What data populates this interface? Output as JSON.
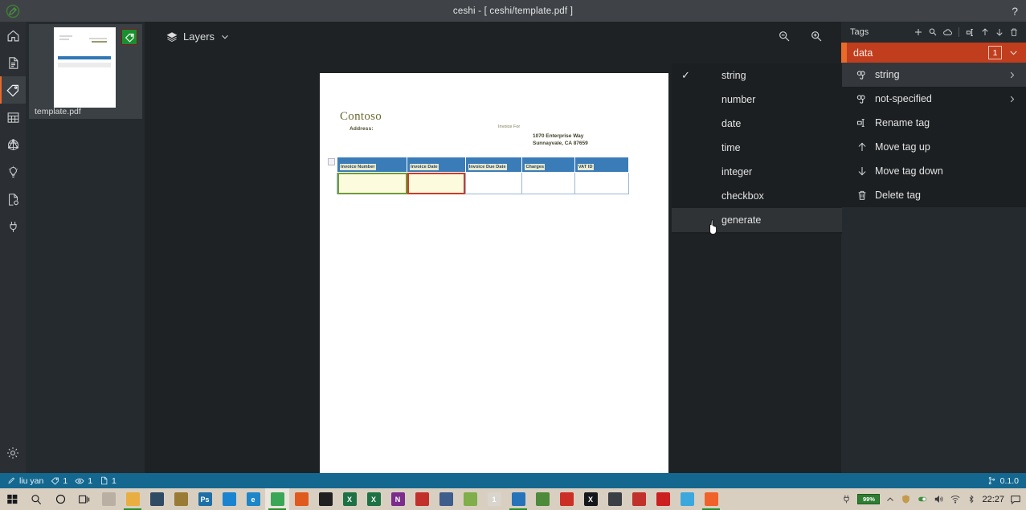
{
  "window": {
    "title": "ceshi - [ ceshi/template.pdf ]",
    "logo_icon": "tag-logo-icon",
    "help_icon": "help-question-icon"
  },
  "rail": {
    "items": [
      {
        "name": "home",
        "icon": "home-icon",
        "active": false
      },
      {
        "name": "documents",
        "icon": "document-icon",
        "active": false
      },
      {
        "name": "tags",
        "icon": "tag-icon",
        "active": true
      },
      {
        "name": "table",
        "icon": "table-grid-icon",
        "active": false
      },
      {
        "name": "model",
        "icon": "neural-model-icon",
        "active": false
      },
      {
        "name": "predict",
        "icon": "lightbulb-icon",
        "active": false
      },
      {
        "name": "compose",
        "icon": "document-gear-icon",
        "active": false
      },
      {
        "name": "connections",
        "icon": "plug-connection-icon",
        "active": false
      }
    ],
    "settings": {
      "name": "settings",
      "icon": "gear-icon"
    }
  },
  "document_panel": {
    "file_name": "template.pdf",
    "badge_icon": "tag-badge-icon"
  },
  "editor_toolbar": {
    "layers_label": "Layers",
    "layers_icon": "layers-icon",
    "chevron_icon": "chevron-down-icon",
    "zoom_out_icon": "zoom-out-icon",
    "zoom_in_icon": "zoom-in-icon"
  },
  "page_document": {
    "company": "Contoso",
    "address_label": "Address:",
    "invoice_for_label": "Invoice For",
    "address_lines": "1070 Enterprise Way<br>Sunnayvale, CA 87659",
    "address_line_1": "1070 Enterprise Way",
    "address_line_2": "Sunnayvale, CA 87659",
    "table": {
      "headers": [
        "Invoice Number",
        "Invoice Date",
        "Invoice Due Date",
        "Charges",
        "VAT ID"
      ],
      "rows": [
        [
          "",
          "",
          "",
          "",
          ""
        ]
      ],
      "selected_cells": [
        {
          "index": 0,
          "outline_color": "#6e9b3a"
        },
        {
          "index": 1,
          "outline_color": "#cc3b2a"
        }
      ],
      "header_bg": "#3a7cb8",
      "header_text_highlight": "#e7e8cd"
    }
  },
  "type_submenu": {
    "items": [
      {
        "label": "string",
        "checked": true,
        "hover": false
      },
      {
        "label": "number",
        "checked": false,
        "hover": false
      },
      {
        "label": "date",
        "checked": false,
        "hover": false
      },
      {
        "label": "time",
        "checked": false,
        "hover": false
      },
      {
        "label": "integer",
        "checked": false,
        "hover": false
      },
      {
        "label": "checkbox",
        "checked": false,
        "hover": false
      },
      {
        "label": "generate",
        "checked": false,
        "hover": true
      }
    ],
    "check_glyph": "✓"
  },
  "tags_panel": {
    "header_label": "Tags",
    "tools": [
      {
        "name": "add-tag",
        "icon": "plus-icon"
      },
      {
        "name": "search-tag",
        "icon": "search-icon"
      },
      {
        "name": "cloud-sync",
        "icon": "cloud-icon"
      },
      {
        "name": "rename-tag",
        "icon": "rename-icon"
      },
      {
        "name": "move-tag-up",
        "icon": "arrow-up-icon"
      },
      {
        "name": "move-tag-down",
        "icon": "arrow-down-icon"
      },
      {
        "name": "delete-tag",
        "icon": "trash-icon"
      }
    ],
    "tag": {
      "name": "data",
      "count": "1",
      "accent_color": "#ea6a2a",
      "row_color": "#c03e1e",
      "caret_icon": "chevron-down-icon"
    },
    "subtags": [
      {
        "label": "string",
        "icon": "link-icon",
        "arrow": "chevron-right-icon",
        "highlighted": true
      },
      {
        "label": "not-specified",
        "icon": "link-icon",
        "arrow": "chevron-right-icon",
        "highlighted": false
      }
    ],
    "context_menu": [
      {
        "label": "Rename tag",
        "icon": "rename-icon"
      },
      {
        "label": "Move tag up",
        "icon": "arrow-up-icon"
      },
      {
        "label": "Move tag down",
        "icon": "arrow-down-icon"
      },
      {
        "label": "Delete tag",
        "icon": "trash-icon"
      }
    ]
  },
  "status_bar": {
    "user": "liu yan",
    "user_icon": "user-pen-icon",
    "metrics": [
      {
        "icon": "tag-icon",
        "value": "1"
      },
      {
        "icon": "eye-icon",
        "value": "1"
      },
      {
        "icon": "document-icon",
        "value": "1"
      }
    ],
    "version": "0.1.0",
    "version_icon": "branch-icon",
    "bg_color": "#14688f"
  },
  "taskbar": {
    "system_buttons": [
      {
        "name": "start",
        "icon": "windows-icon"
      },
      {
        "name": "search",
        "icon": "search-icon"
      },
      {
        "name": "cortana",
        "icon": "circle-icon"
      },
      {
        "name": "task-view",
        "icon": "task-view-icon"
      }
    ],
    "apps": [
      {
        "name": "app-magnifier",
        "label": "",
        "color": "#b9b0a3",
        "running": false,
        "active": false
      },
      {
        "name": "app-explorer",
        "label": "",
        "color": "#e8ae42",
        "running": true,
        "active": false
      },
      {
        "name": "app-media",
        "label": "",
        "color": "#2f4a63",
        "running": false,
        "active": false
      },
      {
        "name": "app-editor",
        "label": "",
        "color": "#9a7b35",
        "running": false,
        "active": false
      },
      {
        "name": "app-photoshop",
        "label": "Ps",
        "color": "#1d6fa5",
        "running": false,
        "active": false
      },
      {
        "name": "app-browser-blue",
        "label": "",
        "color": "#1a84d0",
        "running": false,
        "active": false
      },
      {
        "name": "app-edge",
        "label": "e",
        "color": "#1d86c8",
        "running": false,
        "active": false
      },
      {
        "name": "app-chrome",
        "label": "",
        "color": "#3aa757",
        "running": true,
        "active": true
      },
      {
        "name": "app-firefox",
        "label": "",
        "color": "#e05a1e",
        "running": false,
        "active": false
      },
      {
        "name": "app-terminal",
        "label": "",
        "color": "#202020",
        "running": false,
        "active": false
      },
      {
        "name": "app-excel-1",
        "label": "X",
        "color": "#1e7145",
        "running": false,
        "active": false
      },
      {
        "name": "app-excel-2",
        "label": "X",
        "color": "#1e7145",
        "running": false,
        "active": false
      },
      {
        "name": "app-onenote",
        "label": "N",
        "color": "#7b2c8c",
        "running": false,
        "active": false
      },
      {
        "name": "app-red-tool",
        "label": "",
        "color": "#c2302b",
        "running": false,
        "active": false
      },
      {
        "name": "app-paint",
        "label": "",
        "color": "#3e5c8c",
        "running": false,
        "active": false
      },
      {
        "name": "app-notes",
        "label": "",
        "color": "#7fae4a",
        "running": false,
        "active": false
      },
      {
        "name": "app-number-one",
        "label": "1",
        "color": "#d9d4cc",
        "running": false,
        "active": false
      },
      {
        "name": "app-vscode",
        "label": "",
        "color": "#2673ba",
        "running": true,
        "active": false
      },
      {
        "name": "app-green-tool",
        "label": "",
        "color": "#4d8a3a",
        "running": false,
        "active": false
      },
      {
        "name": "app-red-bird",
        "label": "",
        "color": "#cc2f26",
        "running": false,
        "active": false
      },
      {
        "name": "app-x",
        "label": "X",
        "color": "#14181b",
        "running": false,
        "active": false
      },
      {
        "name": "app-unity",
        "label": "",
        "color": "#3a3f46",
        "running": false,
        "active": false
      },
      {
        "name": "app-kb",
        "label": "",
        "color": "#c2302b",
        "running": false,
        "active": false
      },
      {
        "name": "app-recorder",
        "label": "",
        "color": "#cc2020",
        "running": false,
        "active": false
      },
      {
        "name": "app-cloud-blue",
        "label": "",
        "color": "#3aa8dd",
        "running": false,
        "active": false
      },
      {
        "name": "app-orange-circle",
        "label": "",
        "color": "#f0622a",
        "running": true,
        "active": false
      }
    ],
    "tray": {
      "battery_percent": "99%",
      "clock": "22:27",
      "icons": [
        {
          "name": "charging",
          "icon": "plug-icon"
        },
        {
          "name": "show-hidden",
          "icon": "chevron-up-icon"
        },
        {
          "name": "safety",
          "icon": "shield-icon"
        },
        {
          "name": "sync-green",
          "icon": "sync-icon"
        },
        {
          "name": "volume",
          "icon": "speaker-icon"
        },
        {
          "name": "wifi",
          "icon": "wifi-icon"
        },
        {
          "name": "bluetooth",
          "icon": "bluetooth-icon"
        },
        {
          "name": "notifications",
          "icon": "action-center-icon"
        }
      ]
    }
  }
}
